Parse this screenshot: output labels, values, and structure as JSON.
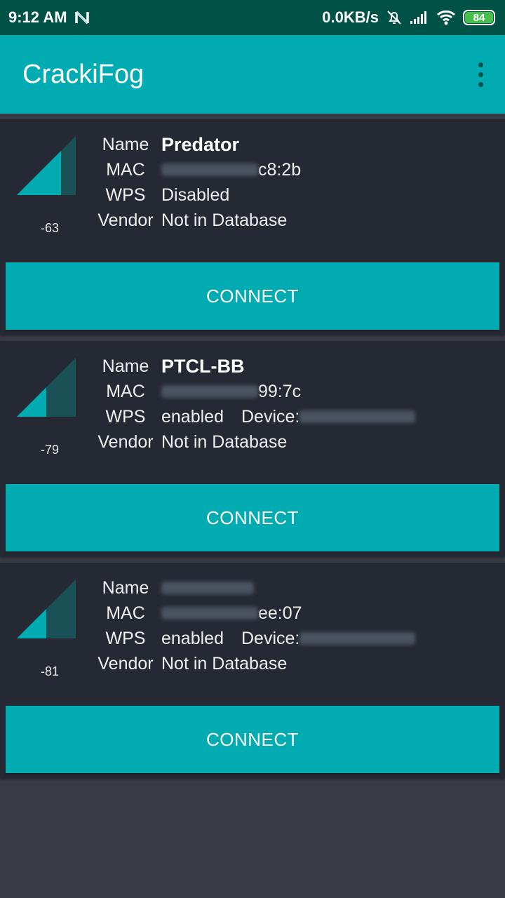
{
  "status_bar": {
    "time": "9:12 AM",
    "network_speed": "0.0KB/s",
    "battery": "84",
    "icons": [
      "notification-n-icon",
      "alarm-off-icon",
      "cell-signal-icon",
      "wifi-icon",
      "battery-icon"
    ]
  },
  "app_bar": {
    "title": "CrackiFog",
    "menu_icon": "more-vert-icon"
  },
  "labels": {
    "name": "Name",
    "mac": "MAC",
    "wps": "WPS",
    "vendor": "Vendor",
    "device": "Device:"
  },
  "networks": [
    {
      "name": "Predator",
      "name_hidden": false,
      "mac_visible": "c8:2b",
      "wps": "Disabled",
      "device_hidden": false,
      "vendor": "Not in Database",
      "rssi": "-63",
      "signal_level": 0.75,
      "connect_label": "CONNECT"
    },
    {
      "name": "PTCL-BB",
      "name_hidden": false,
      "mac_visible": "99:7c",
      "wps": "enabled",
      "device_hidden": true,
      "vendor": "Not in Database",
      "rssi": "-79",
      "signal_level": 0.5,
      "connect_label": "CONNECT"
    },
    {
      "name": "",
      "name_hidden": true,
      "mac_visible": "ee:07",
      "wps": "enabled",
      "device_hidden": true,
      "vendor": "Not in Database",
      "rssi": "-81",
      "signal_level": 0.5,
      "connect_label": "CONNECT"
    }
  ],
  "colors": {
    "status_bar": "#005247",
    "accent": "#00abb2",
    "card": "#252933",
    "background": "#383b45",
    "signal_dim": "#1a5157"
  }
}
